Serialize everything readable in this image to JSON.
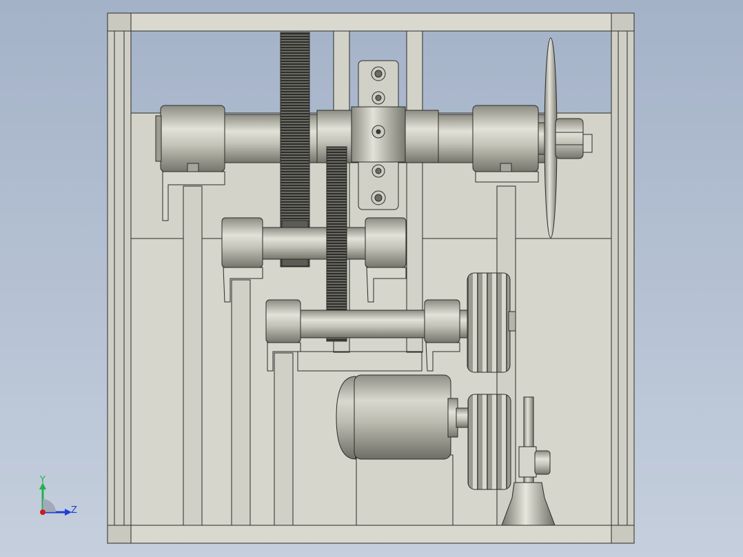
{
  "viewport": {
    "background_top": "#a4b2c8",
    "background_bottom": "#c5cfdd",
    "model": {
      "frame_color": "#d6d6cc",
      "part_light": "#dcdcd2",
      "part_mid": "#b5b5aa",
      "part_dark": "#7b7b72",
      "edge_color": "#2b2b2b"
    }
  },
  "triad": {
    "y_label": "Y",
    "z_label": "Z",
    "y_color": "#22b14c",
    "z_color": "#1f3fd6",
    "origin_color": "#d11a1a"
  }
}
